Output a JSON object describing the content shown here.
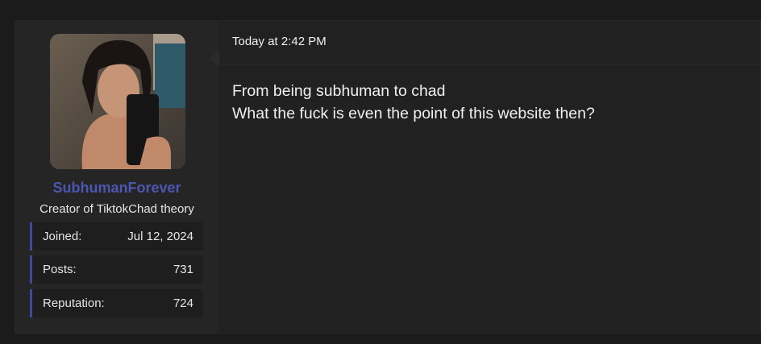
{
  "post": {
    "timestamp": "Today at 2:42 PM",
    "message_lines": [
      "From being subhuman to chad",
      "What the fuck is even the point of this website then?"
    ]
  },
  "user": {
    "username": "SubhumanForever",
    "title": "Creator of TiktokChad theory",
    "avatar_icon": "user-avatar-photo",
    "stats": [
      {
        "label": "Joined:",
        "value": "Jul 12, 2024"
      },
      {
        "label": "Posts:",
        "value": "731"
      },
      {
        "label": "Reputation:",
        "value": "724"
      }
    ]
  },
  "colors": {
    "username": "#4b57b0",
    "stat_accent": "#3f4b9c",
    "background": "#1b1b1c"
  }
}
